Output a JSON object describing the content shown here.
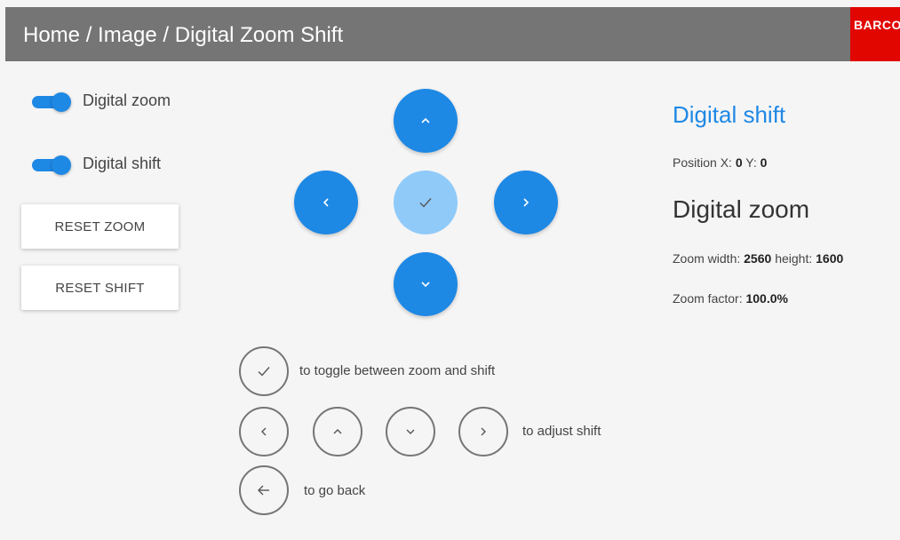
{
  "header": {
    "breadcrumb": "Home / Image / Digital Zoom Shift",
    "logo_text": "BARCO",
    "background": "#757575",
    "logo_color": "#e10600"
  },
  "toggles": [
    {
      "label": "Digital zoom",
      "on": true
    },
    {
      "label": "Digital shift",
      "on": true
    }
  ],
  "buttons": {
    "reset_zoom": "RESET ZOOM",
    "reset_shift": "RESET SHIFT"
  },
  "dpad": {
    "up_icon": "chevron-up-icon",
    "down_icon": "chevron-down-icon",
    "left_icon": "chevron-left-icon",
    "right_icon": "chevron-right-icon",
    "center_icon": "check-icon",
    "accent": "#1e88e5",
    "center_color": "#90caf9"
  },
  "info": {
    "shift_heading": "Digital shift",
    "position_label_x": "Position X:",
    "position_x": "0",
    "position_label_y": "Y:",
    "position_y": "0",
    "zoom_heading": "Digital zoom",
    "zoom_width_label": "Zoom width:",
    "zoom_width": "2560",
    "zoom_height_label": "height:",
    "zoom_height": "1600",
    "zoom_factor_label": "Zoom factor:",
    "zoom_factor": "100.0%"
  },
  "hints": {
    "toggle": "to toggle between zoom and shift",
    "adjust": "to adjust shift",
    "back": "to go back"
  }
}
